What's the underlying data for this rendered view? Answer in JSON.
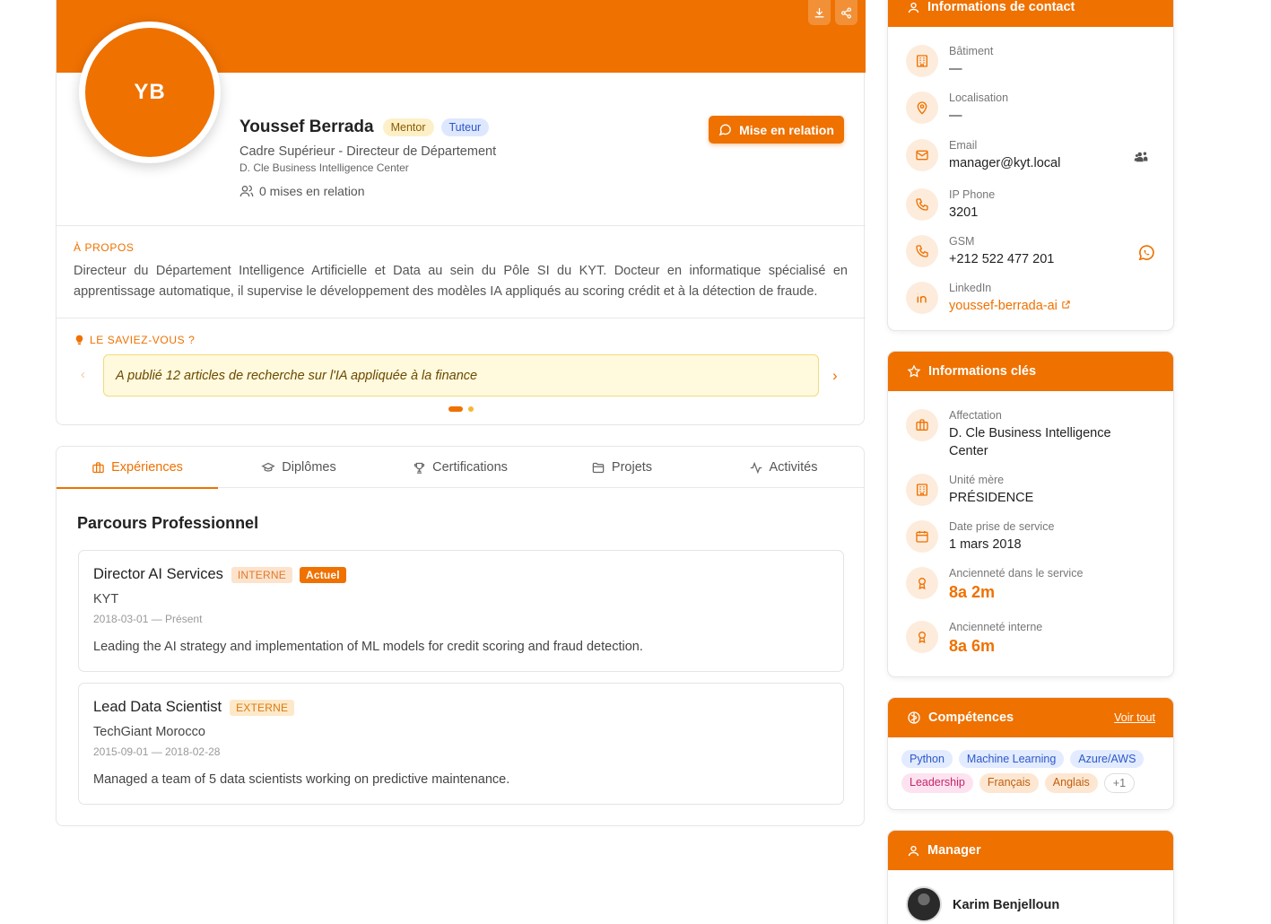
{
  "profile": {
    "initials": "YB",
    "name": "Youssef Berrada",
    "badges": [
      "Mentor",
      "Tuteur"
    ],
    "job_title": "Cadre Supérieur - Directeur de Département",
    "department": "D. Cle Business Intelligence Center",
    "relations": "0 mises en relation",
    "connect_button": "Mise en relation"
  },
  "about": {
    "label": "À PROPOS",
    "text": "Directeur du Département Intelligence Artificielle et Data au sein du Pôle SI du KYT. Docteur en informatique spécialisé en apprentissage automatique, il supervise le développement des modèles IA appliqués au scoring crédit et à la détection de fraude."
  },
  "fun_fact": {
    "label": "LE SAVIEZ-VOUS ?",
    "text": "A publié 12 articles de recherche sur l'IA appliquée à la finance",
    "prev": "‹",
    "next": "›"
  },
  "tabs": [
    "Expériences",
    "Diplômes",
    "Certifications",
    "Projets",
    "Activités"
  ],
  "parcours": {
    "title": "Parcours Professionnel",
    "experiences": [
      {
        "title": "Director AI Services",
        "type": "INTERNE",
        "current": "Actuel",
        "company": "KYT",
        "dates": "2018-03-01 — Présent",
        "description": "Leading the AI strategy and implementation of ML models for credit scoring and fraud detection."
      },
      {
        "title": "Lead Data Scientist",
        "type": "EXTERNE",
        "company": "TechGiant Morocco",
        "dates": "2015-09-01 — 2018-02-28",
        "description": "Managed a team of 5 data scientists working on predictive maintenance."
      }
    ]
  },
  "contact": {
    "title": "Informations de contact",
    "items": [
      {
        "label": "Bâtiment",
        "value": "—",
        "icon": "building-icon"
      },
      {
        "label": "Localisation",
        "value": "—",
        "icon": "map-pin-icon"
      },
      {
        "label": "Email",
        "value": "manager@kyt.local",
        "icon": "mail-icon"
      },
      {
        "label": "IP Phone",
        "value": "3201",
        "icon": "phone-icon"
      },
      {
        "label": "GSM",
        "value": "+212 522 477 201",
        "icon": "phone-icon"
      },
      {
        "label": "LinkedIn",
        "value": "youssef-berrada-ai",
        "icon": "linkedin-icon"
      }
    ]
  },
  "key_info": {
    "title": "Informations clés",
    "items": [
      {
        "label": "Affectation",
        "value": "D. Cle Business Intelligence Center"
      },
      {
        "label": "Unité mère",
        "value": "PRÉSIDENCE"
      },
      {
        "label": "Date prise de service",
        "value": "1 mars 2018"
      },
      {
        "label": "Ancienneté dans le service",
        "value": "8a 2m"
      },
      {
        "label": "Ancienneté interne",
        "value": "8a 6m"
      }
    ]
  },
  "skills": {
    "title": "Compétences",
    "see_all": "Voir tout",
    "items": [
      "Python",
      "Machine Learning",
      "Azure/AWS",
      "Leadership",
      "Français",
      "Anglais"
    ],
    "more": "+1"
  },
  "manager": {
    "title": "Manager",
    "name": "Karim Benjelloun"
  },
  "colors": {
    "accent": "#ef7100"
  }
}
